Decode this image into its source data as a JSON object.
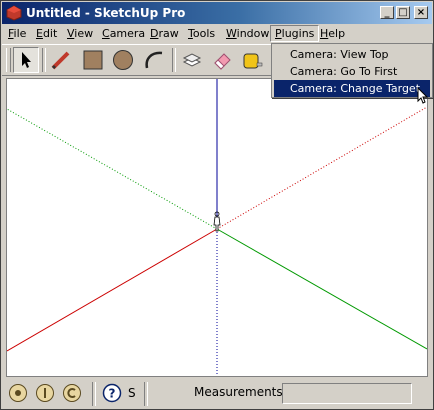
{
  "window": {
    "title": "Untitled - SketchUp Pro"
  },
  "menubar": {
    "items": [
      {
        "label": "File",
        "u": "F",
        "rest": "ile"
      },
      {
        "label": "Edit",
        "u": "E",
        "rest": "dit"
      },
      {
        "label": "View",
        "u": "V",
        "rest": "iew"
      },
      {
        "label": "Camera",
        "u": "C",
        "rest": "amera"
      },
      {
        "label": "Draw",
        "u": "D",
        "rest": "raw"
      },
      {
        "label": "Tools",
        "u": "T",
        "rest": "ools"
      },
      {
        "label": "Window",
        "u": "W",
        "rest": "indow"
      },
      {
        "label": "Plugins",
        "u": "P",
        "rest": "lugins"
      },
      {
        "label": "Help",
        "u": "H",
        "rest": "elp"
      }
    ]
  },
  "plugins_menu": {
    "items": [
      {
        "label": "Camera: View Top"
      },
      {
        "label": "Camera: Go To First Scene"
      },
      {
        "label": "Camera: Change Target"
      }
    ],
    "highlighted_index": 2
  },
  "toolbar": {
    "tools": [
      {
        "name": "select-icon"
      },
      {
        "name": "pencil-icon"
      },
      {
        "name": "rectangle-icon"
      },
      {
        "name": "circle-icon"
      },
      {
        "name": "arc-icon"
      },
      {
        "name": "make-component-icon"
      },
      {
        "name": "eraser-icon"
      },
      {
        "name": "tape-measure-icon"
      }
    ]
  },
  "statusbar": {
    "status_text": "S",
    "measurements_label": "Measurements",
    "measurements_value": ""
  },
  "colors": {
    "title_gradient_start": "#0a246a",
    "menu_highlight": "#0a246a",
    "axis_red": "#cc0000",
    "axis_green": "#009900",
    "axis_blue": "#000099"
  }
}
